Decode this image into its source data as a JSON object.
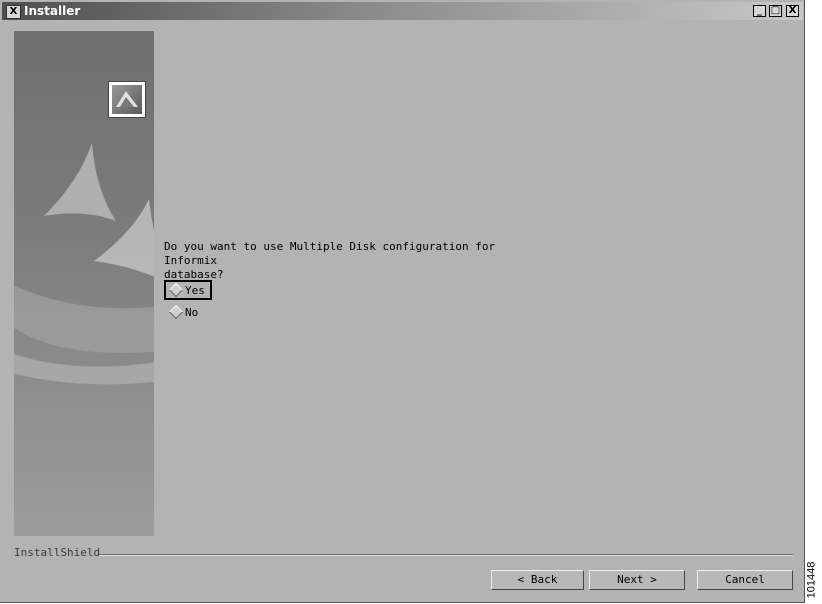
{
  "window": {
    "title": "Installer",
    "app_icon_glyph": "X"
  },
  "controls": {
    "minimize": "_",
    "maximize": "□",
    "close": "X"
  },
  "content": {
    "question": "Do you want to use Multiple Disk configuration for Informix\ndatabase?",
    "options": [
      {
        "label": "Yes",
        "selected": true
      },
      {
        "label": "No",
        "selected": false
      }
    ]
  },
  "footer": {
    "brand": "InstallShield",
    "back_label": "< Back",
    "next_label": "Next >",
    "cancel_label": "Cancel"
  },
  "figure_id": "101448",
  "colors": {
    "window_bg": "#b3b3b3",
    "title_dark": "#4e4e4e",
    "sidebar": "#7c7c7c"
  }
}
